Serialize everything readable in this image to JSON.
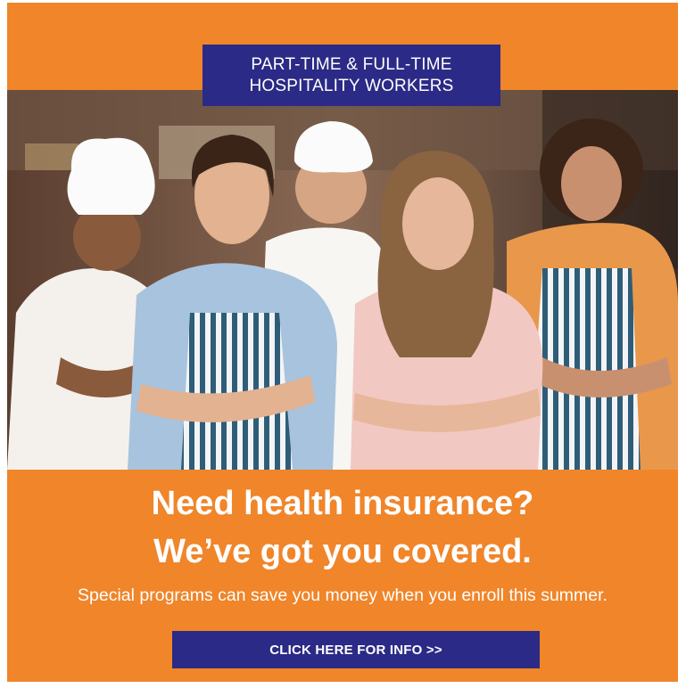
{
  "banner": {
    "line1": "PART-TIME & FULL-TIME",
    "line2": "HOSPITALITY WORKERS"
  },
  "headline": {
    "line1": "Need health insurance?",
    "line2": "We’ve got you covered."
  },
  "subtext": "Special programs can save you money when you enroll this summer.",
  "cta": {
    "label": "CLICK HERE FOR INFO >>"
  },
  "colors": {
    "background": "#f0852a",
    "banner": "#2b2a86",
    "text": "#ffffff"
  }
}
